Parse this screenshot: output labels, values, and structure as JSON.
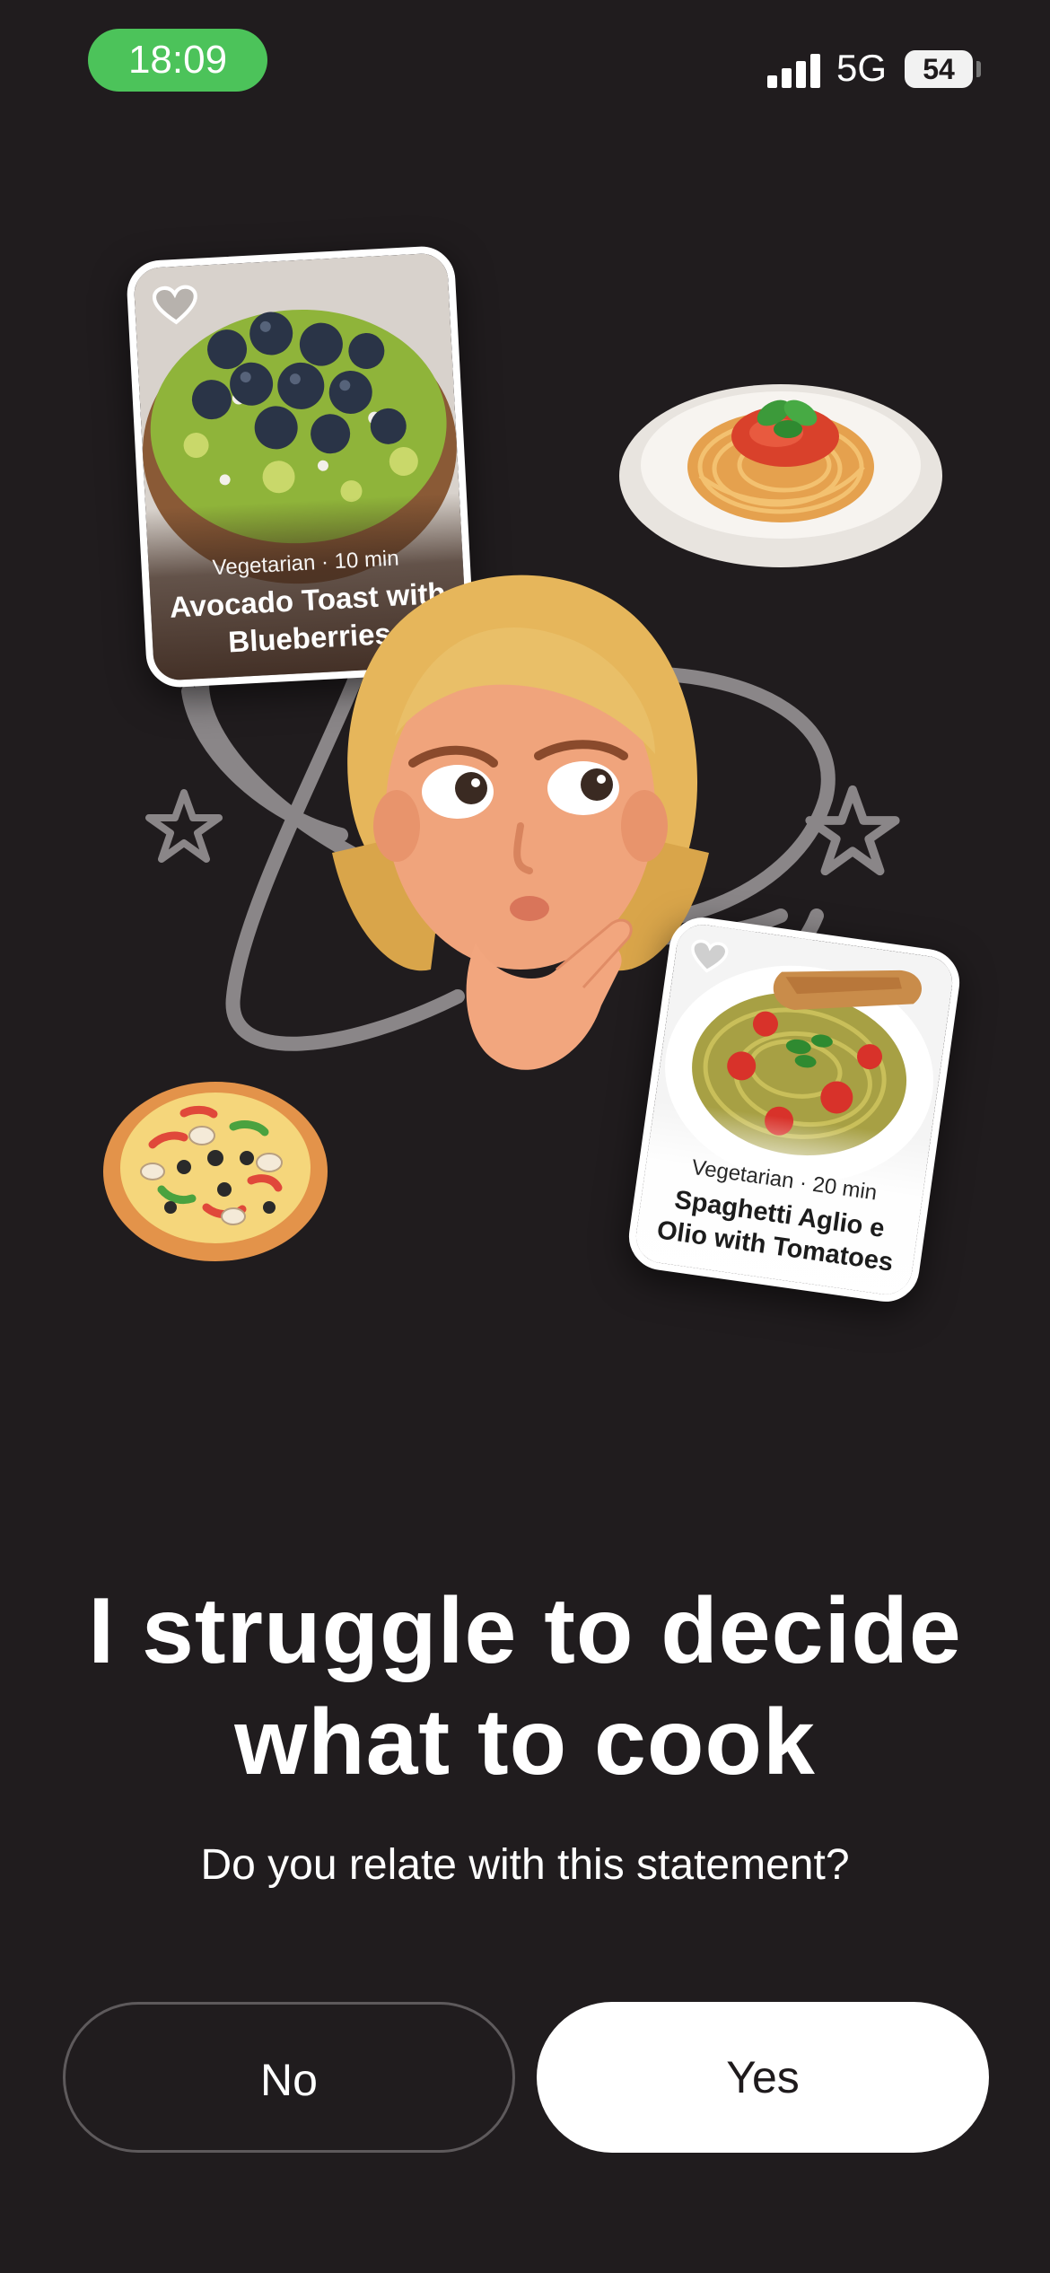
{
  "status_bar": {
    "time": "18:09",
    "network": "5G",
    "battery": "54"
  },
  "illustration": {
    "card_1": {
      "meta": "Vegetarian · 10 min",
      "title": "Avocado Toast with Blueberries"
    },
    "card_2": {
      "meta": "Vegetarian · 20 min",
      "title": "Spaghetti Aglio e Olio with Tomatoes"
    }
  },
  "headline": {
    "line1": "I struggle to decide",
    "line2": "what to cook"
  },
  "subline": "Do you relate with this statement?",
  "buttons": {
    "no": "No",
    "yes": "Yes"
  },
  "colors": {
    "background": "#201c1e",
    "status_pill": "#4cc35a",
    "primary_button": "#ffffff"
  }
}
